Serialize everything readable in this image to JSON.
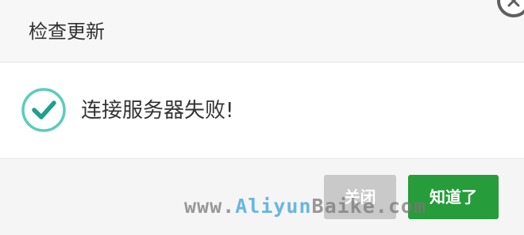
{
  "dialog": {
    "title": "检查更新",
    "message": "连接服务器失败!",
    "close_button_label": "关闭",
    "ok_button_label": "知道了",
    "status_icon": "check-circle-icon",
    "close_icon": "close-icon"
  },
  "watermark": {
    "prefix": "www.",
    "brand_a": "Aliyun",
    "brand_b": "Baike",
    "suffix": ".com"
  },
  "colors": {
    "accent_teal": "#26b5a0",
    "ok_button": "#279c3a",
    "close_button": "#c9c9c9"
  }
}
